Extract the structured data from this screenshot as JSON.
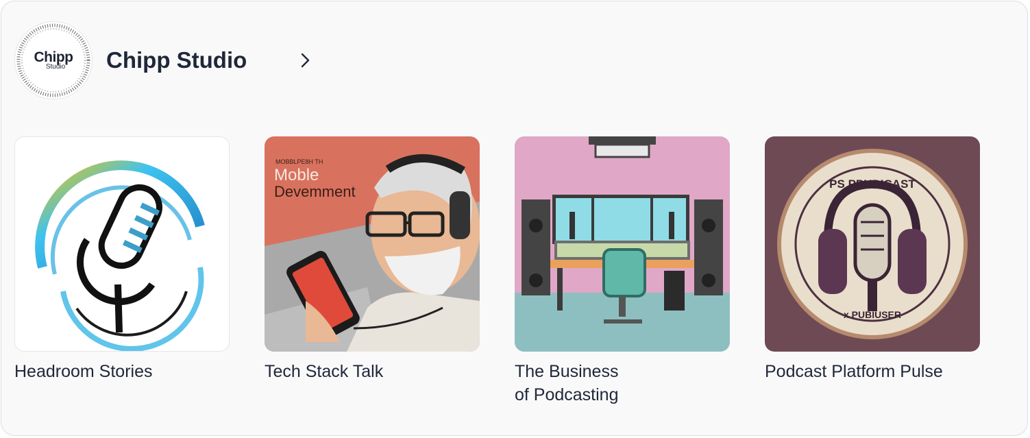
{
  "studio": {
    "name": "Chipp Studio",
    "avatar_big": "Chipp",
    "avatar_small": "Studio",
    "chevron_icon": "chevron-right-icon"
  },
  "shows": [
    {
      "title": "Headroom Stories",
      "cover_icon": "microphone-logo-icon"
    },
    {
      "title": "Tech Stack Talk",
      "cover_small_text": "MOBBLPE8H TH",
      "cover_big_text_1": "Moble",
      "cover_big_text_2": "Devemment"
    },
    {
      "title": "The Business\nof Podcasting",
      "cover_icon": "studio-desk-illustration"
    },
    {
      "title": "Podcast Platform Pulse",
      "cover_top_text": "PS PPUDICAST",
      "cover_bottom_text": "x PUBIUSER"
    }
  ],
  "colors": {
    "card_bg": "#f9f9fa",
    "text": "#1f2738"
  }
}
